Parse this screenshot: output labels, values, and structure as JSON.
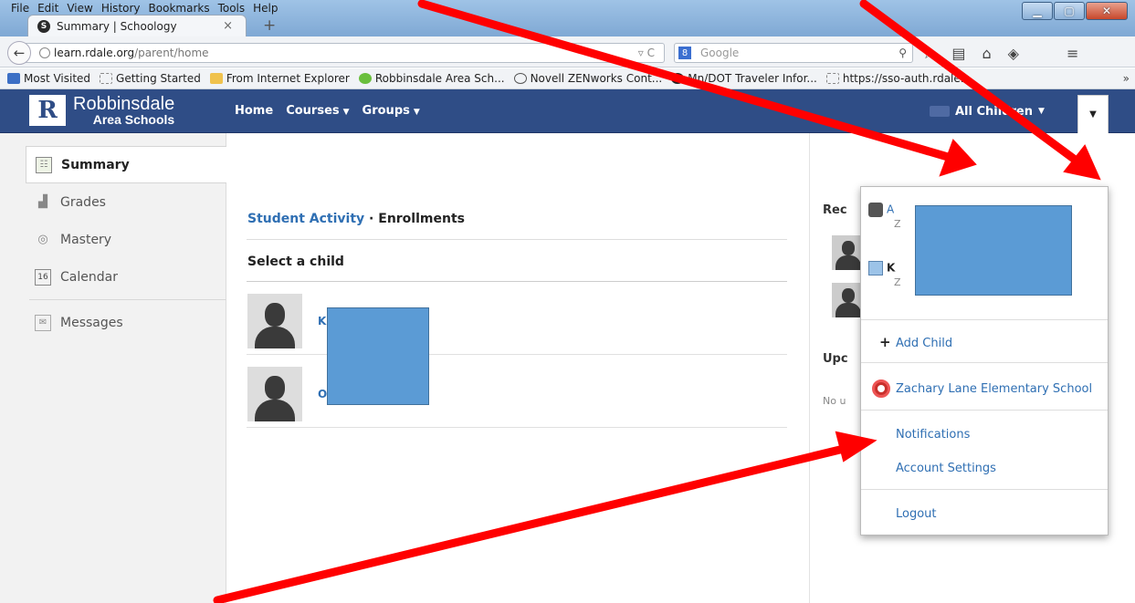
{
  "browser": {
    "menu": [
      "File",
      "Edit",
      "View",
      "History",
      "Bookmarks",
      "Tools",
      "Help"
    ],
    "tab_title": "Summary | Schoology",
    "url": "learn.rdale.org/parent/home",
    "url_domain": "learn.rdale.org",
    "url_path": "/parent/home",
    "search_placeholder": "Google",
    "bookmarks": [
      "Most Visited",
      "Getting Started",
      "From Internet Explorer",
      "Robbinsdale Area Sch...",
      "Novell ZENworks Cont...",
      "Mn/DOT Traveler Infor...",
      "https://sso-auth.rdale..."
    ],
    "bookmarks_more": "»"
  },
  "header": {
    "logo_line1": "Robbinsdale",
    "logo_line2": "Area Schools",
    "logo_mark": "R",
    "nav": [
      "Home",
      "Courses",
      "Groups"
    ],
    "child_selector": "All Children"
  },
  "sidebar": {
    "items": [
      {
        "label": "Summary",
        "icon": "summary-icon"
      },
      {
        "label": "Grades",
        "icon": "grades-icon"
      },
      {
        "label": "Mastery",
        "icon": "mastery-icon"
      },
      {
        "label": "Calendar",
        "icon": "calendar-icon",
        "calendar_day": "16"
      },
      {
        "label": "Messages",
        "icon": "envelope-icon"
      }
    ]
  },
  "main": {
    "crumb_link": "Student Activity",
    "crumb_sep": " · ",
    "crumb_current": "Enrollments",
    "section_title": "Select a child",
    "children": [
      {
        "initial": "K"
      },
      {
        "initial": "O"
      }
    ]
  },
  "right": {
    "recent_title": "Rec",
    "upcoming_title": "Upc",
    "no_upcoming": "No u"
  },
  "dropdown": {
    "children": [
      {
        "initial": "A",
        "sub": "Z"
      },
      {
        "initial": "K",
        "sub": "Z"
      }
    ],
    "add_child": "Add Child",
    "school": "Zachary Lane Elementary School",
    "notifications": "Notifications",
    "account_settings": "Account Settings",
    "logout": "Logout"
  },
  "colors": {
    "header_bg": "#2f4d86",
    "link": "#2f6fb3",
    "annotation_arrow": "#ff0000",
    "redaction": "#5b9bd5"
  }
}
